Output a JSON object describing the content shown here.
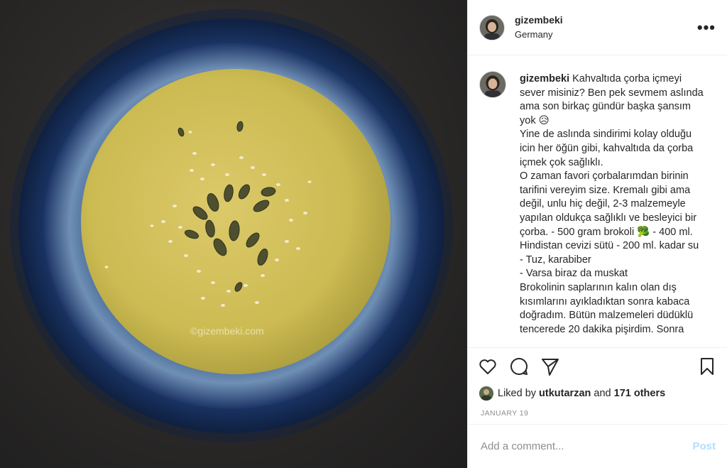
{
  "post": {
    "username": "gizembeki",
    "location": "Germany",
    "more_label": "•••",
    "photo_watermark": "©gizembeki.com"
  },
  "caption": {
    "username": "gizembeki",
    "lines": [
      "Kahvaltıda çorba içmeyi",
      "sever misiniz? Ben pek sevmem aslında",
      "ama son birkaç gündür başka şansım",
      "yok 😥",
      "Yine de aslında sindirimi kolay olduğu",
      "icin her öğün gibi, kahvaltıda da çorba",
      "içmek çok sağlıklı.",
      "O zaman favori çorbalarımdan birinin",
      "tarifini vereyim size. Kremalı gibi ama",
      "değil, unlu hiç değil, 2-3 malzemeyle",
      "yapılan oldukça sağlıklı ve besleyici bir",
      "çorba. - 500 gram brokoli 🥦 - 400 ml.",
      "Hindistan cevizi sütü - 200 ml. kadar su",
      "- Tuz, karabiber",
      "- Varsa biraz da muskat",
      "Brokolinin saplarının kalın olan dış",
      "kısımlarını ayıkladıktan sonra kabaca",
      "doğradım. Bütün malzemeleri düdüklü",
      "tencerede 20 dakika pişirdim. Sonra"
    ]
  },
  "likes": {
    "prefix": "Liked by",
    "user": "utkutarzan",
    "joiner": "and",
    "others": "171 others"
  },
  "date": "JANUARY 19",
  "comment_box": {
    "placeholder": "Add a comment...",
    "post_label": "Post"
  },
  "icons": {
    "like": "heart-icon",
    "comment": "comment-icon",
    "share": "paper-plane-icon",
    "save": "bookmark-icon",
    "more": "more-options-icon"
  }
}
